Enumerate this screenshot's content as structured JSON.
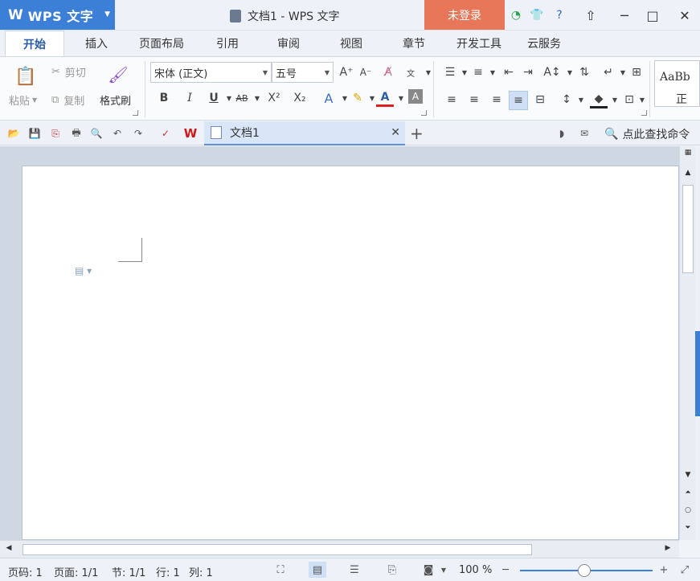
{
  "titlebar": {
    "app_logo": "W",
    "app_name": "WPS 文字",
    "doc_title": "文档1 - WPS 文字",
    "login_label": "未登录"
  },
  "tabs": [
    "开始",
    "插入",
    "页面布局",
    "引用",
    "审阅",
    "视图",
    "章节",
    "开发工具",
    "云服务"
  ],
  "ribbon": {
    "paste_label": "粘贴",
    "cut_label": "剪切",
    "copy_label": "复制",
    "format_painter_label": "格式刷",
    "font_name": "宋体 (正文)",
    "font_size": "五号",
    "style_preview": "AaBb",
    "style_name": "正"
  },
  "quickbar": {
    "doc_tab_name": "文档1",
    "search_label": "点此查找命令"
  },
  "status": {
    "page_code": "页码: 1",
    "pages": "页面: 1/1",
    "section": "节: 1/1",
    "line": "行: 1",
    "column": "列: 1",
    "zoom": "100 %"
  },
  "colors": {
    "brand": "#3b7fd6",
    "login_bg": "#e8775a"
  }
}
